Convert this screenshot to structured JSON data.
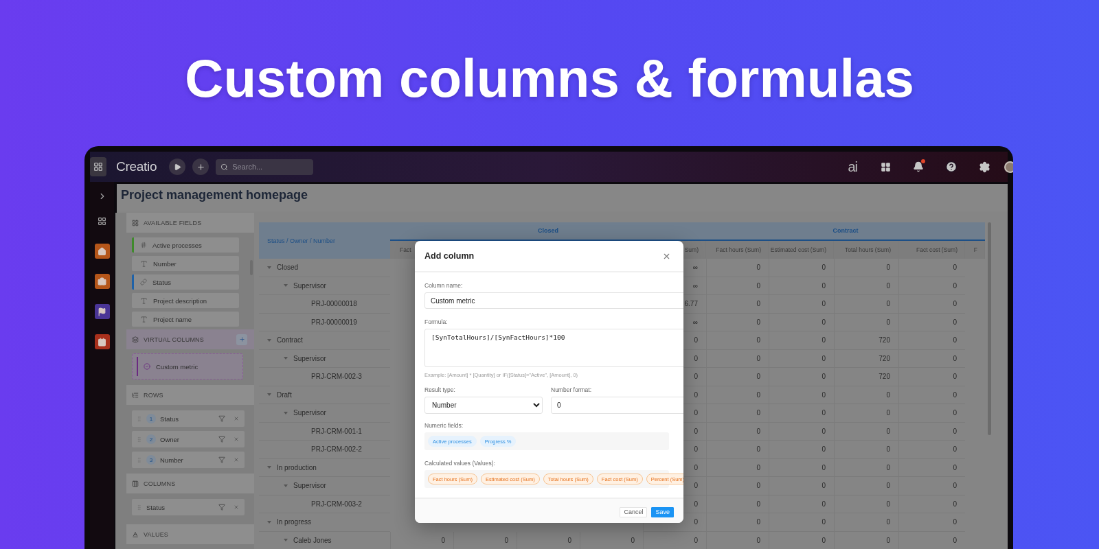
{
  "banner": {
    "title": "Custom columns & formulas"
  },
  "top_bar": {
    "logo": "Creatio",
    "search": {
      "placeholder": "Search..."
    },
    "ai_label": "ai",
    "notifications": {
      "unread": true
    }
  },
  "side_rail": {
    "items": [
      {
        "kind": "home",
        "color": "#b5561a"
      },
      {
        "kind": "briefcase",
        "color": "#b5561a"
      },
      {
        "kind": "flag",
        "color": "#4a3596"
      },
      {
        "kind": "calendar",
        "color": "#a8301c"
      }
    ]
  },
  "page": {
    "title": "Project management homepage"
  },
  "sidebar": {
    "available_fields": {
      "title": "AVAILABLE FIELDS",
      "items": [
        {
          "label": "Active processes",
          "kind": "number",
          "color": "#3f8a2c"
        },
        {
          "label": "Number",
          "kind": "text"
        },
        {
          "label": "Status",
          "kind": "lookup",
          "color": "#1f62a8"
        },
        {
          "label": "Project description",
          "kind": "text"
        },
        {
          "label": "Project name",
          "kind": "text"
        }
      ]
    },
    "virtual_columns": {
      "title": "VIRTUAL COLUMNS",
      "items": [
        {
          "label": "Custom metric"
        }
      ]
    },
    "rows": {
      "title": "ROWS",
      "items": [
        {
          "index": "1",
          "label": "Status"
        },
        {
          "index": "2",
          "label": "Owner"
        },
        {
          "index": "3",
          "label": "Number"
        }
      ]
    },
    "columns": {
      "title": "COLUMNS",
      "items": [
        {
          "label": "Status"
        }
      ]
    },
    "values": {
      "title": "VALUES"
    }
  },
  "table": {
    "row_header": "Status / Owner / Number",
    "groups": [
      {
        "label": "Closed",
        "columns": [
          "Fact",
          "Sum)"
        ]
      },
      {
        "label": "Contract",
        "columns": [
          "Fact hours (Sum)",
          "Estimated cost (Sum)",
          "Total hours (Sum)",
          "Fact cost (Sum)",
          "F"
        ]
      }
    ],
    "rows": [
      {
        "label": "Closed",
        "expanded": true,
        "values": [
          "∞",
          "0",
          "0",
          "0",
          "0"
        ],
        "children": [
          {
            "label": "Supervisor",
            "expanded": true,
            "values": [
              "∞",
              "0",
              "0",
              "0",
              "0"
            ],
            "children": [
              {
                "label": "PRJ-00000018",
                "values": [
                  "6.77",
                  "0",
                  "0",
                  "0",
                  "0"
                ]
              },
              {
                "label": "PRJ-00000019",
                "values": [
                  "∞",
                  "0",
                  "0",
                  "0",
                  "0"
                ]
              }
            ]
          }
        ]
      },
      {
        "label": "Contract",
        "expanded": true,
        "values": [
          "0",
          "0",
          "0",
          "720",
          "0"
        ],
        "children": [
          {
            "label": "Supervisor",
            "expanded": true,
            "values": [
              "0",
              "0",
              "0",
              "720",
              "0"
            ],
            "children": [
              {
                "label": "PRJ-CRM-002-3",
                "values": [
                  "0",
                  "0",
                  "0",
                  "720",
                  "0"
                ]
              }
            ]
          }
        ]
      },
      {
        "label": "Draft",
        "expanded": true,
        "values": [
          "0",
          "0",
          "0",
          "0",
          "0"
        ],
        "children": [
          {
            "label": "Supervisor",
            "expanded": true,
            "values": [
              "0",
              "0",
              "0",
              "0",
              "0"
            ],
            "children": [
              {
                "label": "PRJ-CRM-001-1",
                "values": [
                  "0",
                  "0",
                  "0",
                  "0",
                  "0"
                ]
              },
              {
                "label": "PRJ-CRM-002-2",
                "values": [
                  "0",
                  "0",
                  "0",
                  "0",
                  "0"
                ]
              }
            ]
          }
        ]
      },
      {
        "label": "In production",
        "expanded": true,
        "values": [
          "0",
          "0",
          "0",
          "0",
          "0"
        ],
        "children": [
          {
            "label": "Supervisor",
            "expanded": true,
            "values": [
              "0",
              "0",
              "0",
              "0",
              "0"
            ],
            "children": [
              {
                "label": "PRJ-CRM-003-2",
                "values": [
                  "0",
                  "0",
                  "0",
                  "0",
                  "0"
                ]
              }
            ]
          }
        ]
      },
      {
        "label": "In progress",
        "expanded": true,
        "values": [
          "0",
          "0",
          "0",
          "0",
          "0"
        ],
        "children": [
          {
            "label": "Caleb Jones",
            "expanded": true,
            "values": [
              "0",
              "0",
              "0",
              "0",
              "0",
              "0",
              "0",
              "0",
              "0"
            ]
          }
        ]
      }
    ]
  },
  "modal": {
    "title": "Add column",
    "column_name": {
      "label": "Column name:",
      "value": "Custom metric"
    },
    "formula": {
      "label": "Formula:",
      "value": "[SynTotalHours]/[SynFactHours]*100",
      "hint": "Example: [Amount] * [Quantity] or IF([Status]=\"Active\", [Amount], 0)"
    },
    "result_type": {
      "label": "Result type:",
      "value": "Number"
    },
    "number_format": {
      "label": "Number format:",
      "value": "0"
    },
    "numeric_fields": {
      "label": "Numeric fields:",
      "items": [
        "Active processes",
        "Progress %"
      ]
    },
    "calculated_values": {
      "label": "Calculated values (Values):",
      "items": [
        "Fact hours (Sum)",
        "Estimated cost (Sum)",
        "Total hours (Sum)",
        "Fact cost (Sum)",
        "Percent (Sum)"
      ]
    },
    "buttons": [
      {
        "label": "Cancel",
        "kind": "secondary"
      },
      {
        "label": "Save",
        "kind": "primary"
      }
    ]
  }
}
